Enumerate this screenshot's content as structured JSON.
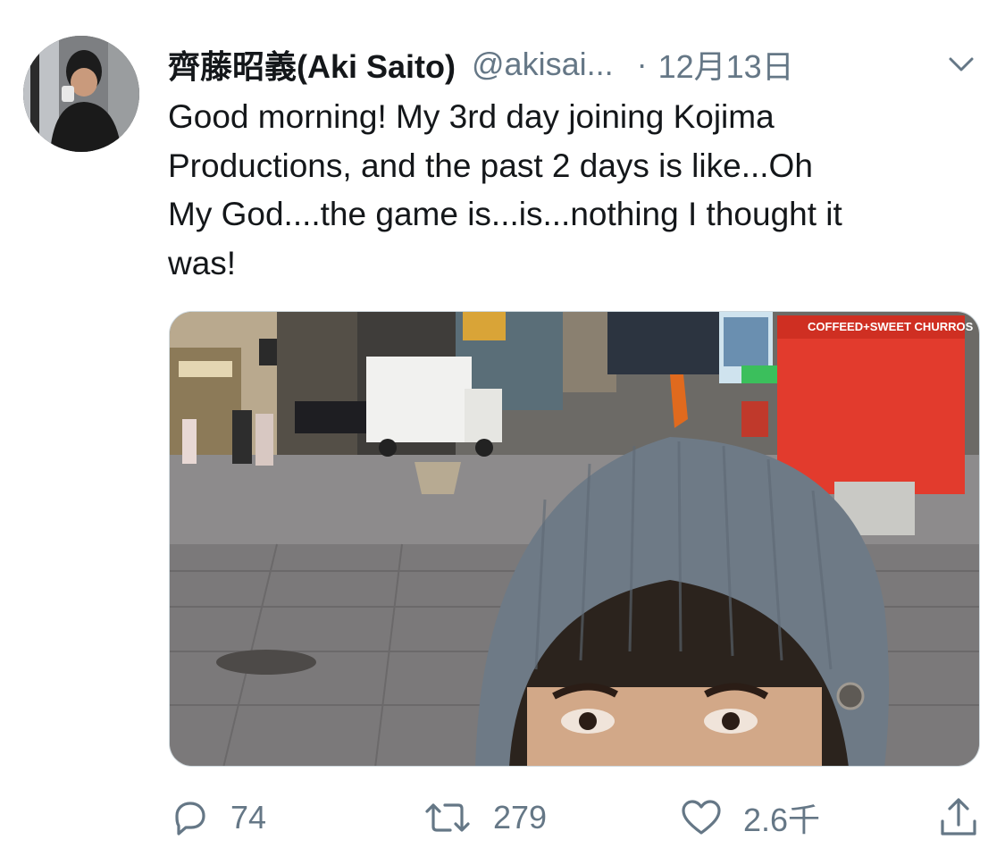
{
  "tweet": {
    "display_name": "齊藤昭義(Aki Saito)",
    "handle": "@akisai...",
    "separator": "·",
    "timestamp": "12月13日",
    "text_lines": [
      "Good morning! My 3rd day joining Kojima",
      "Productions, and the past 2 days is like...Oh",
      "My God....the game is...is...nothing I thought it",
      "was!"
    ],
    "media": {
      "signs": {
        "cafe": "COFFEED+SWEET CHURROS"
      }
    }
  },
  "actions": {
    "reply_count": "74",
    "retweet_count": "279",
    "like_count": "2.6千"
  },
  "icons": {
    "caret": "chevron-down-icon",
    "reply": "reply-icon",
    "retweet": "retweet-icon",
    "like": "heart-icon",
    "share": "share-icon"
  },
  "colors": {
    "text": "#14171a",
    "secondary": "#657786",
    "border": "#cfd9de"
  }
}
